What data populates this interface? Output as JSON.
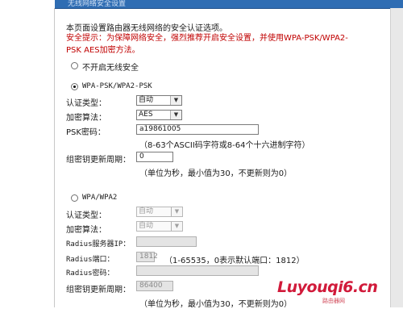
{
  "header": {
    "title": "无线网络安全设置"
  },
  "intro": "本页面设置路由器无线网络的安全认证选项。",
  "tip": "安全提示：为保障网络安全，强烈推荐开启安全设置，并使用WPA-PSK/WPA2-PSK AES加密方法。",
  "options": {
    "none_label": "不开启无线安全",
    "psk": {
      "label": "WPA-PSK/WPA2-PSK",
      "auth_type_label": "认证类型：",
      "auth_type_value": "自动",
      "encryption_label": "加密算法：",
      "encryption_value": "AES",
      "psk_password_label": "PSK密码：",
      "psk_password_value": "a19861005",
      "psk_hint": "（8-63个ASCII码字符或8-64个十六进制字符）",
      "group_key_label": "组密钥更新周期：",
      "group_key_value": "0",
      "group_key_hint": "（单位为秒，最小值为30，不更新则为0）"
    },
    "wpa": {
      "label": "WPA/WPA2",
      "auth_type_label": "认证类型：",
      "auth_type_value": "自动",
      "encryption_label": "加密算法：",
      "encryption_value": "自动",
      "radius_ip_label": "Radius服务器IP：",
      "radius_ip_value": "",
      "radius_port_label": "Radius端口：",
      "radius_port_value": "1812",
      "radius_port_hint": "（1-65535，0表示默认端口：1812）",
      "radius_password_label": "Radius密码：",
      "radius_password_value": "",
      "group_key_label": "组密钥更新周期：",
      "group_key_value": "86400",
      "group_key_hint": "（单位为秒，最小值为30，不更新则为0）"
    }
  },
  "watermark": {
    "text": "Luyouqi6.cn",
    "sub": "路由器网"
  }
}
